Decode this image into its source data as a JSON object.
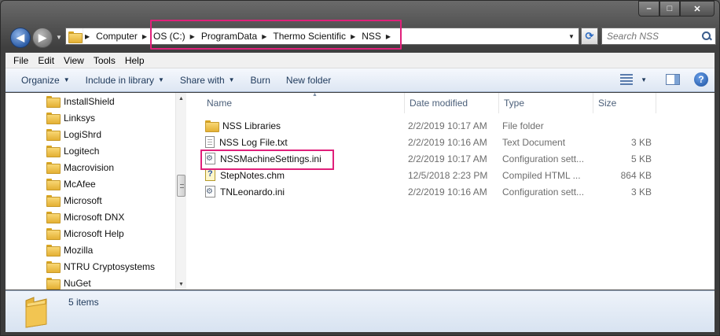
{
  "window": {
    "caption": {
      "minimize": "–",
      "maximize": "□",
      "close": "✕"
    }
  },
  "navigation": {
    "back_glyph": "◀",
    "forward_glyph": "▶",
    "breadcrumbs": [
      "Computer",
      "OS (C:)",
      "ProgramData",
      "Thermo Scientific",
      "NSS"
    ],
    "refresh_glyph": "⟳",
    "search_placeholder": "Search NSS"
  },
  "menu": [
    "File",
    "Edit",
    "View",
    "Tools",
    "Help"
  ],
  "commands": [
    {
      "label": "Organize",
      "has_dropdown": true
    },
    {
      "label": "Include in library",
      "has_dropdown": true
    },
    {
      "label": "Share with",
      "has_dropdown": true
    },
    {
      "label": "Burn",
      "has_dropdown": false
    },
    {
      "label": "New folder",
      "has_dropdown": false
    }
  ],
  "nav_tree": [
    "InstallShield",
    "Linksys",
    "LogiShrd",
    "Logitech",
    "Macrovision",
    "McAfee",
    "Microsoft",
    "Microsoft DNX",
    "Microsoft Help",
    "Mozilla",
    "NTRU Cryptosystems",
    "NuGet"
  ],
  "columns": {
    "name": "Name",
    "date": "Date modified",
    "type": "Type",
    "size": "Size"
  },
  "files": [
    {
      "name": "NSS Libraries",
      "date": "2/2/2019 10:17 AM",
      "type": "File folder",
      "size": "",
      "icon": "folder-icon"
    },
    {
      "name": "NSS Log File.txt",
      "date": "2/2/2019 10:16 AM",
      "type": "Text Document",
      "size": "3 KB",
      "icon": "text-file-icon"
    },
    {
      "name": "NSSMachineSettings.ini",
      "date": "2/2/2019 10:17 AM",
      "type": "Configuration sett...",
      "size": "5 KB",
      "icon": "config-file-icon"
    },
    {
      "name": "StepNotes.chm",
      "date": "12/5/2018 2:23 PM",
      "type": "Compiled HTML ...",
      "size": "864 KB",
      "icon": "help-file-icon"
    },
    {
      "name": "TNLeonardo.ini",
      "date": "2/2/2019 10:16 AM",
      "type": "Configuration sett...",
      "size": "3 KB",
      "icon": "config-file-icon"
    }
  ],
  "status": {
    "item_count": "5 items"
  },
  "colors": {
    "highlight": "#e0207a",
    "accent": "#1e395b"
  }
}
